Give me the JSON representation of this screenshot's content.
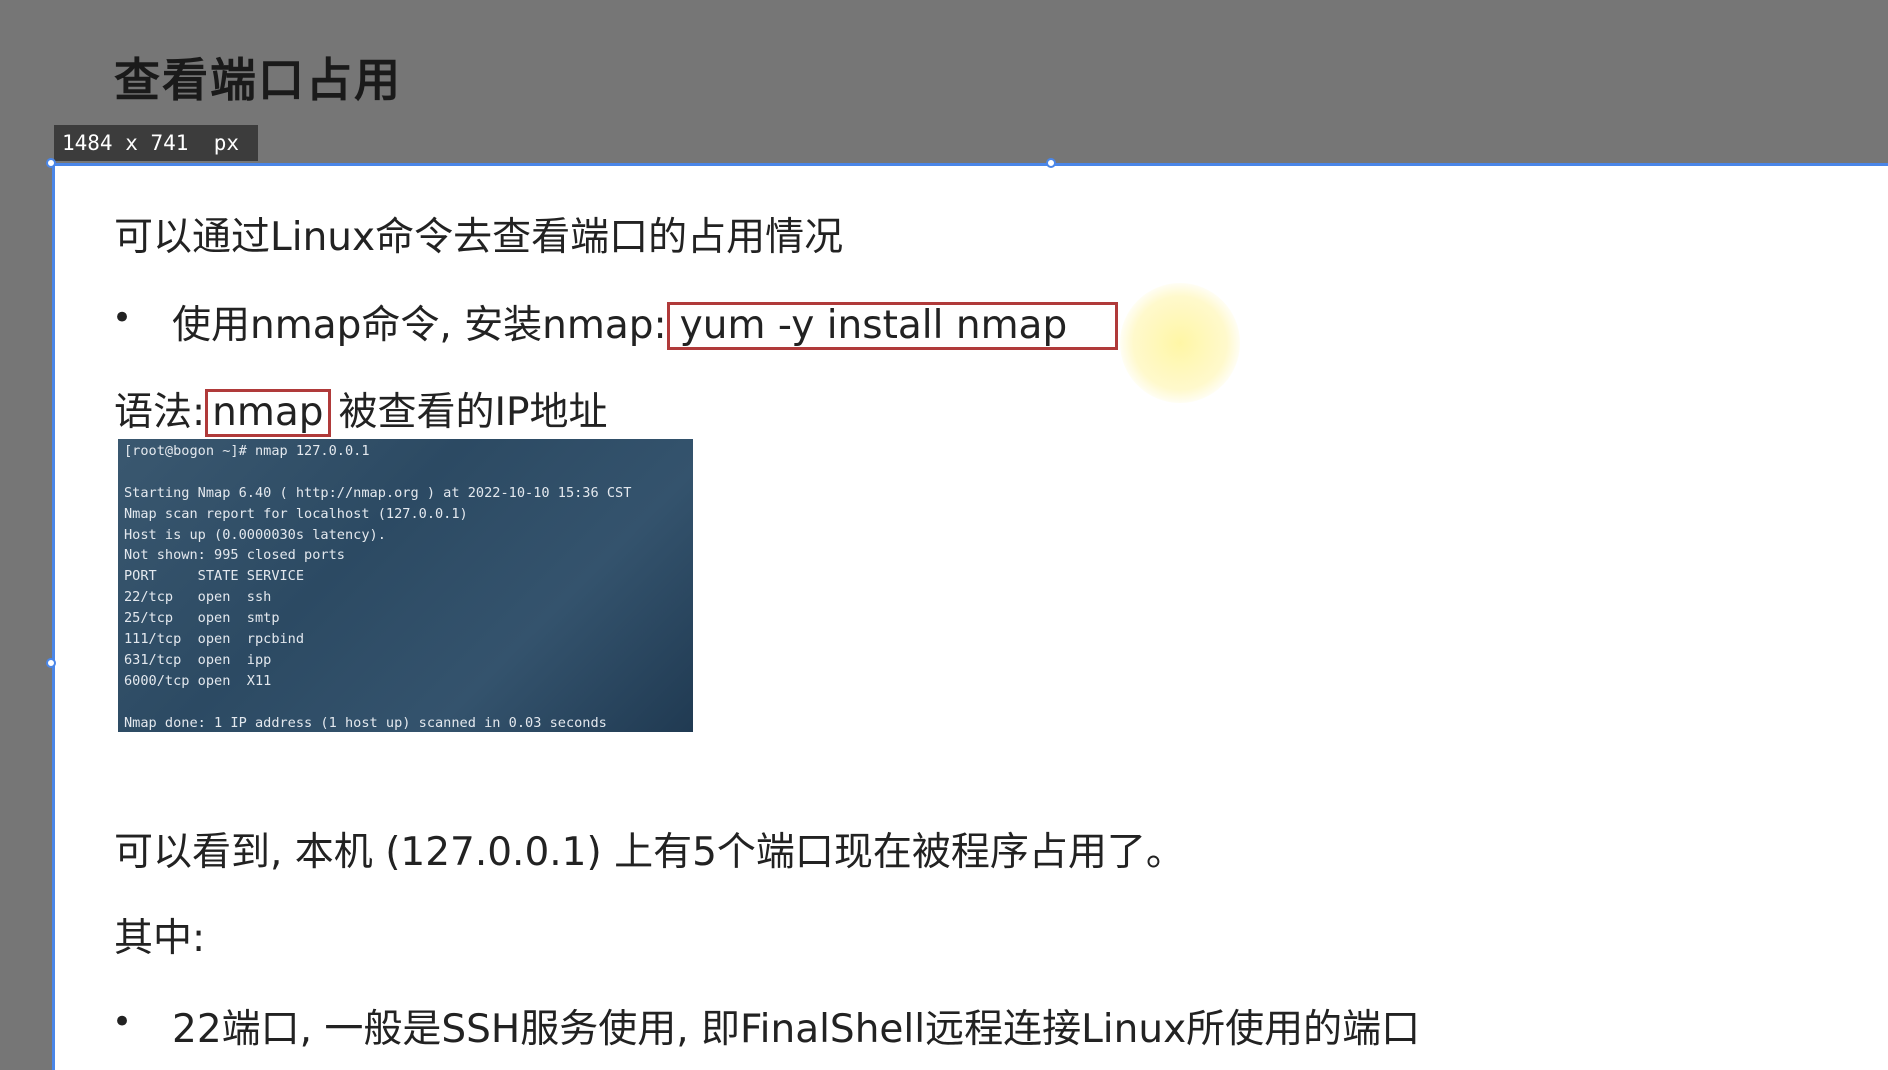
{
  "page": {
    "title": "查看端口占用",
    "size_badge": "1484 x 741  px"
  },
  "content": {
    "intro": "可以通过Linux命令去查看端口的占用情况",
    "bullet1": {
      "text": "使用nmap命令, 安装nmap:",
      "command": "yum -y install nmap"
    },
    "syntax": {
      "label": "语法:",
      "command": "nmap",
      "rest": "被查看的IP地址"
    },
    "terminal_lines": [
      "[root@bogon ~]# nmap 127.0.0.1",
      "",
      "Starting Nmap 6.40 ( http://nmap.org ) at 2022-10-10 15:36 CST",
      "Nmap scan report for localhost (127.0.0.1)",
      "Host is up (0.0000030s latency).",
      "Not shown: 995 closed ports",
      "PORT     STATE SERVICE",
      "22/tcp   open  ssh",
      "25/tcp   open  smtp",
      "111/tcp  open  rpcbind",
      "631/tcp  open  ipp",
      "6000/tcp open  X11",
      "",
      "Nmap done: 1 IP address (1 host up) scanned in 0.03 seconds"
    ],
    "summary": "可以看到, 本机 (127.0.0.1) 上有5个端口现在被程序占用了。",
    "among": "其中:",
    "bullet2": "22端口, 一般是SSH服务使用, 即FinalShell远程连接Linux所使用的端口"
  },
  "colors": {
    "background": "#767676",
    "selection": "#4a86e8",
    "code_border": "#b03a3a"
  }
}
